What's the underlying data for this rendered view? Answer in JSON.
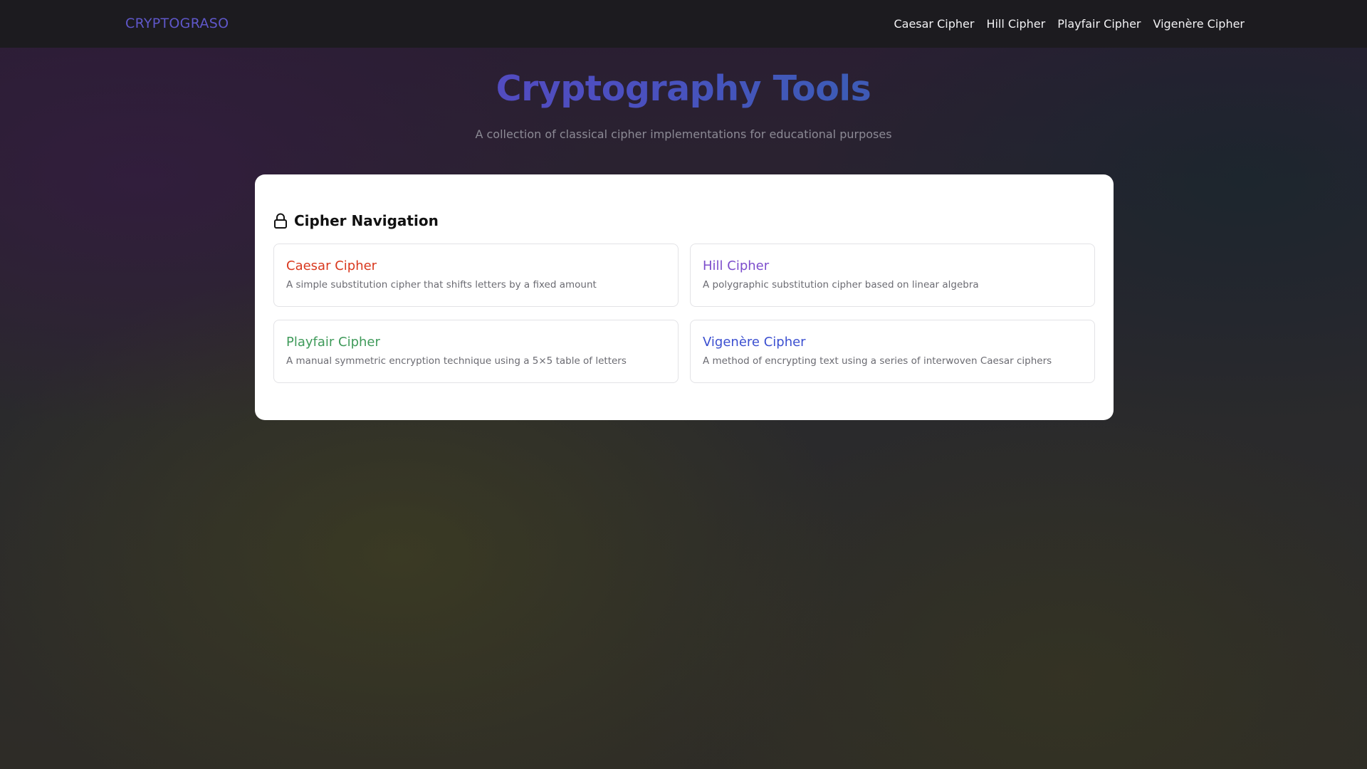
{
  "nav": {
    "brand": "CRYPTOGRASO",
    "links": [
      {
        "label": "Caesar Cipher"
      },
      {
        "label": "Hill Cipher"
      },
      {
        "label": "Playfair Cipher"
      },
      {
        "label": "Vigenère Cipher"
      }
    ]
  },
  "hero": {
    "title": "Cryptography Tools",
    "subtitle": "A collection of classical cipher implementations for educational purposes"
  },
  "panel": {
    "icon": "lock-icon",
    "title": "Cipher Navigation",
    "items": [
      {
        "name": "Caesar Cipher",
        "description": "A simple substitution cipher that shifts letters by a fixed amount",
        "color": "#d9381e"
      },
      {
        "name": "Hill Cipher",
        "description": "A polygraphic substitution cipher based on linear algebra",
        "color": "#7c4dcc"
      },
      {
        "name": "Playfair Cipher",
        "description": "A manual symmetric encryption technique using a 5×5 table of letters",
        "color": "#3f9a5a"
      },
      {
        "name": "Vigenère Cipher",
        "description": "A method of encrypting text using a series of interwoven Caesar ciphers",
        "color": "#3b4fd0"
      }
    ]
  },
  "colors": {
    "brand": "#5f57c9",
    "navbar_bg": "#1c1b1f",
    "title_gradient_start": "#6d3fbf",
    "title_gradient_end": "#3d5bb6"
  }
}
